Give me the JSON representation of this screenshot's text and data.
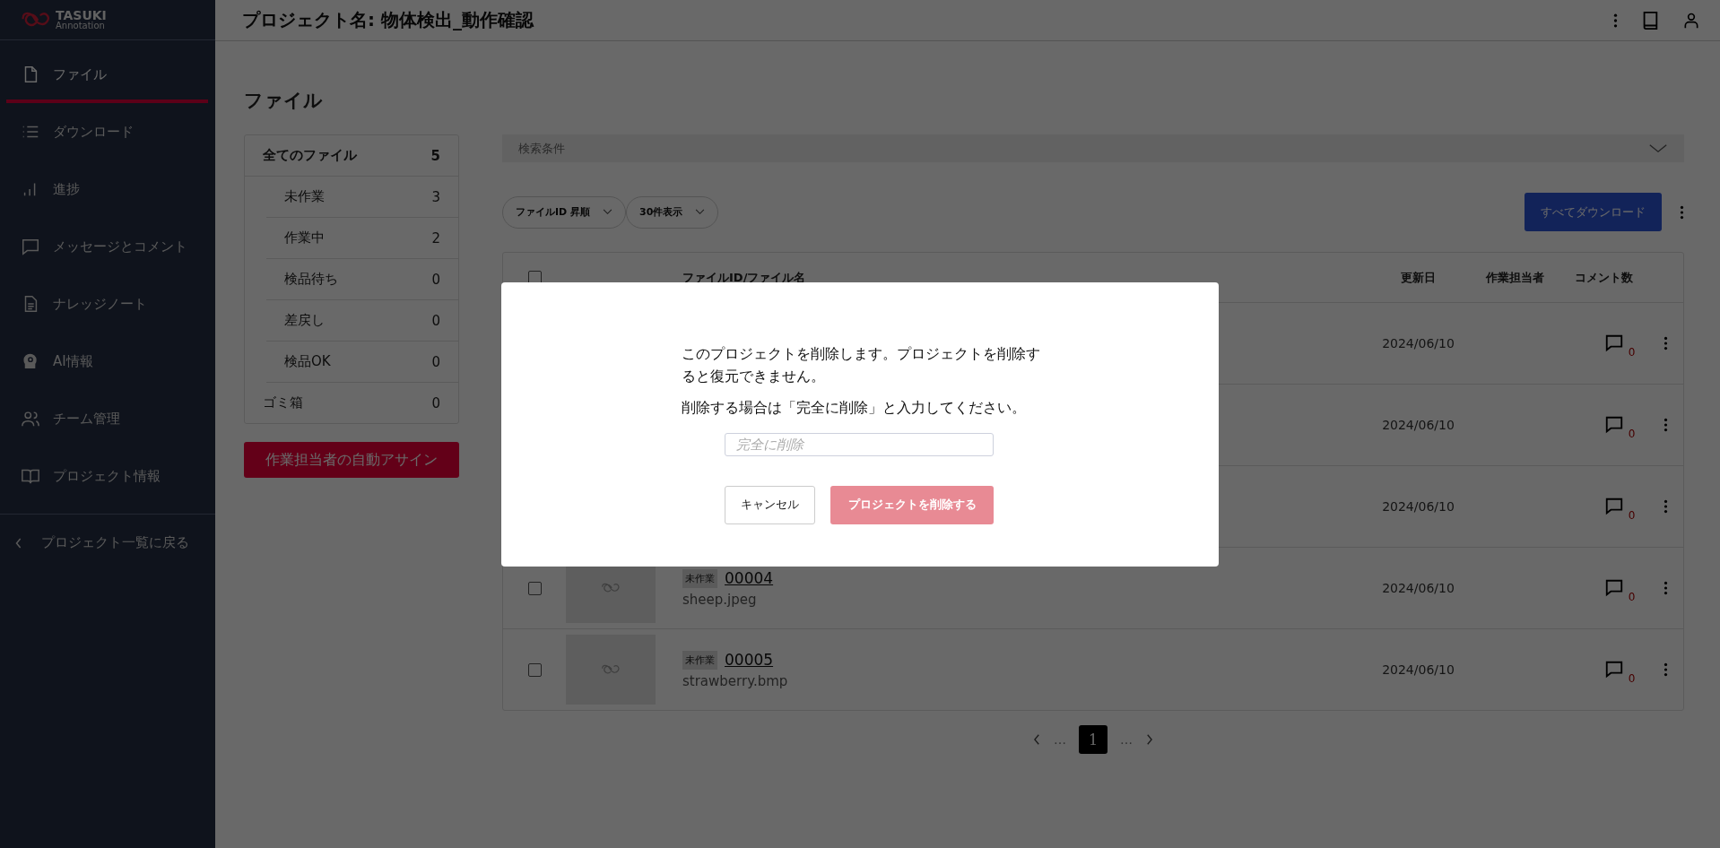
{
  "sidebar": {
    "logo": {
      "name": "TASUKI",
      "sub": "Annotation"
    },
    "items": [
      {
        "label": "ファイル",
        "kind": "file",
        "selected": true
      },
      {
        "label": "ダウンロード",
        "kind": "list",
        "selected": false
      },
      {
        "label": "進捗",
        "kind": "bars",
        "selected": false
      },
      {
        "label": "メッセージとコメント",
        "kind": "chat",
        "selected": false
      },
      {
        "label": "ナレッジノート",
        "kind": "doc",
        "selected": false
      },
      {
        "label": "AI情報",
        "kind": "head",
        "selected": false
      },
      {
        "label": "チーム管理",
        "kind": "people",
        "selected": false
      },
      {
        "label": "プロジェクト情報",
        "kind": "book",
        "selected": false
      }
    ],
    "back_link": "プロジェクト一覧に戻る"
  },
  "header": {
    "title": "プロジェクト名: 物体検出_動作確認"
  },
  "page_title": "ファイル",
  "status_filter": [
    {
      "label": "全てのファイル",
      "count": "5",
      "kind": "total",
      "selected": true
    },
    {
      "label": "未作業",
      "count": "3",
      "kind": "sub",
      "selected": false
    },
    {
      "label": "作業中",
      "count": "2",
      "kind": "sub",
      "selected": false
    },
    {
      "label": "検品待ち",
      "count": "0",
      "kind": "sub",
      "selected": false
    },
    {
      "label": "差戻し",
      "count": "0",
      "kind": "sub",
      "selected": false
    },
    {
      "label": "検品OK",
      "count": "0",
      "kind": "sub",
      "selected": false
    },
    {
      "label": "ゴミ箱",
      "count": "0",
      "kind": "trash",
      "selected": false
    }
  ],
  "auto_assign_button": "作業担当者の自動アサイン",
  "search_panel": {
    "label": "検索条件",
    "expanded": false
  },
  "dropdowns": [
    "ファイルID 昇順",
    "30件表示"
  ],
  "download_all_button": "すべてダウンロード",
  "table": {
    "columns": [
      "ファイルID/ファイル名",
      "更新日",
      "作業担当者",
      "コメント数"
    ],
    "all_checked": false,
    "rows": [
      {
        "updated": "2024/06/10",
        "comments": "0"
      },
      {
        "updated": "2024/06/10",
        "comments": "0"
      },
      {
        "updated": "2024/06/10",
        "comments": "0"
      },
      {
        "checked": false,
        "status": "未作業",
        "file_id": "00004",
        "file_name": "sheep.jpeg",
        "updated": "2024/06/10",
        "comments": "0"
      },
      {
        "checked": false,
        "status": "未作業",
        "file_id": "00005",
        "file_name": "strawberry.bmp",
        "updated": "2024/06/10",
        "comments": "0"
      }
    ]
  },
  "pagination": {
    "before": "…",
    "pages": [
      {
        "label": "1",
        "selected": true
      }
    ],
    "after": "…"
  },
  "dialog": {
    "message": "このプロジェクトを削除します。プロジェクトを削除すると復元できません。",
    "instruction": "削除する場合は「完全に削除」と入力してください。",
    "input": {
      "placeholder": "完全に削除"
    },
    "buttons": [
      {
        "label": "キャンセル",
        "kind": "secondary",
        "disabled": false
      },
      {
        "label": "プロジェクトを削除する",
        "kind": "danger",
        "disabled": true
      }
    ]
  }
}
